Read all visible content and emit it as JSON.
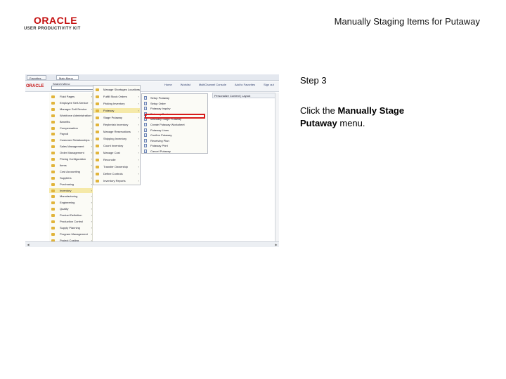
{
  "header": {
    "logo_brand": "ORACLE",
    "logo_product": "USER PRODUCTIVITY KIT",
    "title": "Manually Staging Items for Putaway"
  },
  "instructions": {
    "step": "Step 3",
    "prefix": "Click the ",
    "target": "Manually Stage Putaway",
    "suffix": " menu."
  },
  "screenshot": {
    "tabs": [
      "Favorites",
      "Main Menu"
    ],
    "search_label": "Search Menu:",
    "brand": "ORACLE",
    "links": [
      "Home",
      "Worklist",
      "MultiChannel Console",
      "Add to Favorites",
      "Sign out"
    ],
    "pagelet_label": "Personalize Content | Layout",
    "nav_items": [
      "Fluid Pages",
      "Employee Self-Service",
      "Manager Self-Service",
      "Workforce Administration",
      "Benefits",
      "Compensation",
      "Payroll",
      "Customer Relationships",
      "Sales Management",
      "Order Management",
      "Pricing Configuration",
      "Items",
      "Cost Accounting",
      "Suppliers",
      "Purchasing",
      "Inventory",
      "Manufacturing",
      "Engineering",
      "Quality",
      "Product Definition",
      "Production Control",
      "Supply Planning",
      "Program Management",
      "Project Costing"
    ],
    "active_nav_index": 15,
    "flyout1_items": [
      "Manage Shortages Locations",
      "Fulfill Stock Orders",
      "Picking Inventory",
      "Putaway",
      "Stage Putaway",
      "Replenish Inventory",
      "Manage Reservations",
      "Shipping Inventory",
      "Count Inventory",
      "Manage Cost",
      "Reconcile",
      "Transfer Ownership",
      "Define Controls",
      "Inventory Reports"
    ],
    "active_flyout1_index": 3,
    "flyout2_items": [
      "Setup Putaway",
      "Setup Order",
      "Putaway Inquiry",
      "Putaway Review",
      "Manually Stage Putaway",
      "Create Putaway Worksheet",
      "Putaway Lines",
      "Confirm Putaway",
      "Receiving Plan",
      "Putaway Print",
      "Cancel Putaway"
    ]
  }
}
